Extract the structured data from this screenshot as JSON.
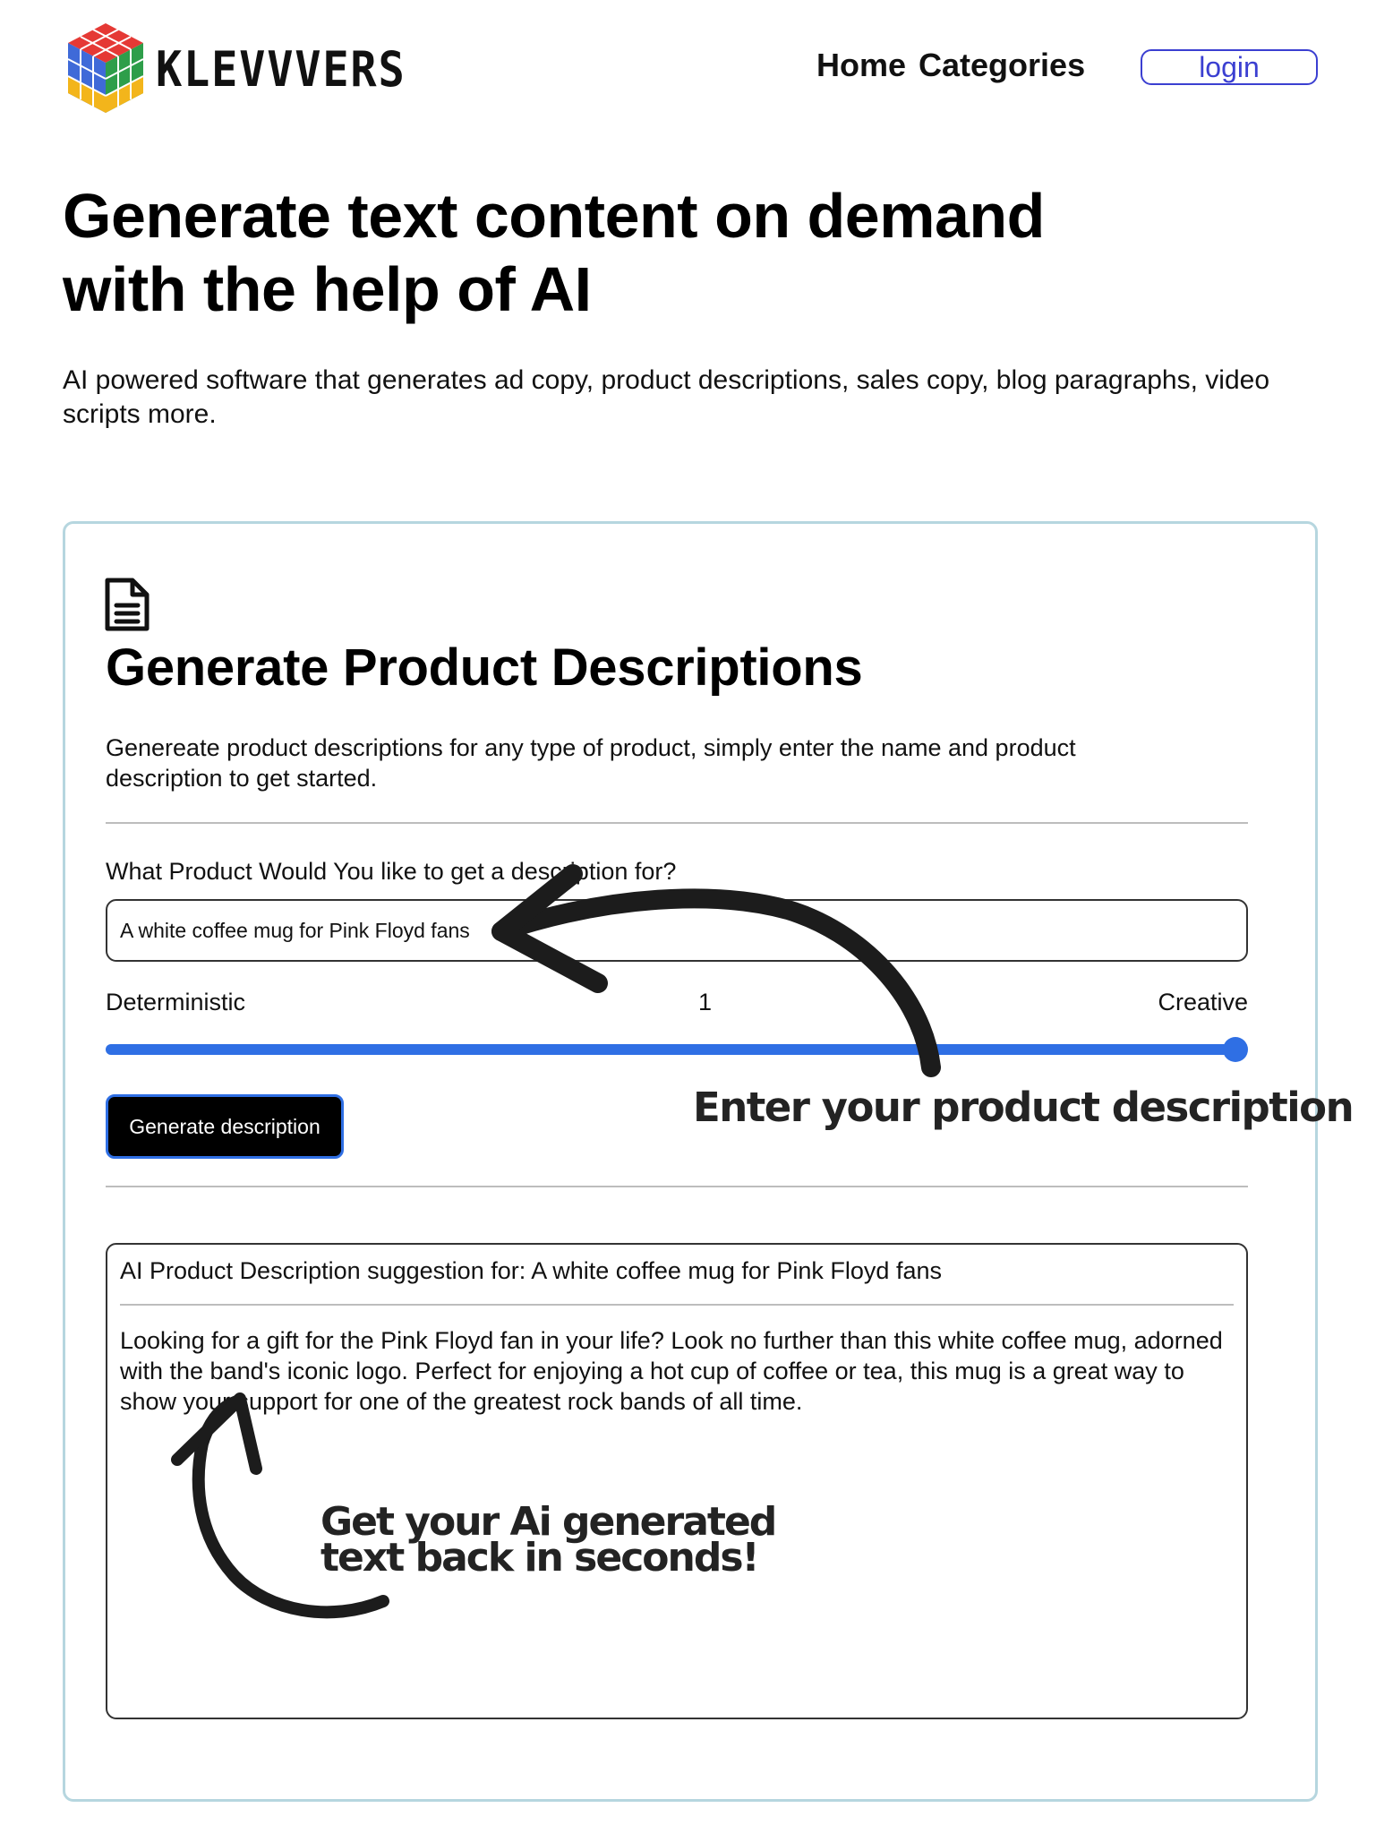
{
  "brand": {
    "name": "KLEVVVERS",
    "logo_icon": "rubiks-cube-logo"
  },
  "nav": {
    "home": "Home",
    "categories": "Categories",
    "login": "login"
  },
  "hero": {
    "title_line1": "Generate text content on demand",
    "title_line2": "with the help of AI",
    "subtitle": "AI powered software that generates ad copy, product descriptions, sales copy, blog paragraphs, video scripts more."
  },
  "tool": {
    "icon": "document-icon",
    "title": "Generate Product Descriptions",
    "description": "Genereate product descriptions for any type of product, simply enter the name and product description to get started.",
    "input_label": "What Product Would You like to get a description for?",
    "input_value": "A white coffee mug for Pink Floyd fans",
    "slider": {
      "left_label": "Deterministic",
      "right_label": "Creative",
      "value": "1",
      "fraction": 1.0
    },
    "button_label": "Generate description",
    "output": {
      "header": "AI Product Description suggestion for: A white coffee mug for Pink Floyd fans",
      "text": "Looking for a gift for the Pink Floyd fan in your life? Look no further than this white coffee mug, adorned with the band's iconic logo. Perfect for enjoying a hot cup of coffee or tea, this mug is a great way to show your support for one of the greatest rock bands of all time."
    }
  },
  "annotations": {
    "enter": "Enter your product description",
    "get_line1": "Get your Ai generated",
    "get_line2": "text back in seconds!"
  },
  "colors": {
    "accent": "#2f6fe4",
    "login_border": "#3b3fd1",
    "card_border": "#b6d6df",
    "button_bg": "#000000"
  }
}
